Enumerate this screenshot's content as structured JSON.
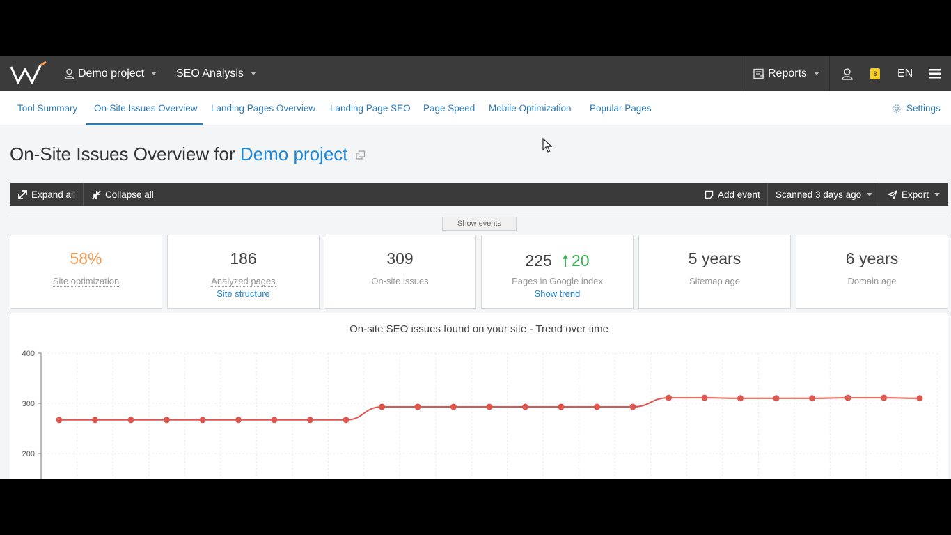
{
  "topbar": {
    "project": "Demo project",
    "section": "SEO Analysis",
    "reports": "Reports",
    "notification_count": "8",
    "language": "EN"
  },
  "tabs": [
    {
      "label": "Tool Summary"
    },
    {
      "label": "On-Site Issues Overview"
    },
    {
      "label": "Landing Pages Overview"
    },
    {
      "label": "Landing Page SEO"
    },
    {
      "label": "Page Speed"
    },
    {
      "label": "Mobile Optimization"
    },
    {
      "label": "Popular Pages"
    }
  ],
  "settings_label": "Settings",
  "page": {
    "title_prefix": "On-Site Issues Overview for",
    "project_name": "Demo project"
  },
  "toolbar": {
    "expand_all": "Expand all",
    "collapse_all": "Collapse all",
    "add_event": "Add event",
    "scanned": "Scanned 3 days ago",
    "export": "Export"
  },
  "show_events": "Show events",
  "stats": [
    {
      "value": "58%",
      "label": "Site optimization"
    },
    {
      "value": "186",
      "label": "Analyzed pages",
      "link": "Site structure"
    },
    {
      "value": "309",
      "label": "On-site issues"
    },
    {
      "value": "225",
      "delta": "20",
      "label": "Pages in Google index",
      "link": "Show trend"
    },
    {
      "value": "5 years",
      "label": "Sitemap age"
    },
    {
      "value": "6 years",
      "label": "Domain age"
    }
  ],
  "colors": {
    "accent": "#1f87d3",
    "orange": "#f39c55",
    "green": "#3cb055",
    "series": "#e0554e"
  },
  "chart_data": {
    "type": "line",
    "title": "On-site SEO issues found on your site - Trend over time",
    "ylim": [
      200,
      400
    ],
    "yticks": [
      400,
      300,
      200
    ],
    "grid": true,
    "series": [
      {
        "values": [
          267,
          267,
          267,
          267,
          267,
          267,
          267,
          267,
          267,
          293,
          293,
          293,
          293,
          293,
          293,
          293,
          293,
          311,
          311,
          310,
          310,
          310,
          311,
          311,
          310
        ]
      }
    ]
  }
}
